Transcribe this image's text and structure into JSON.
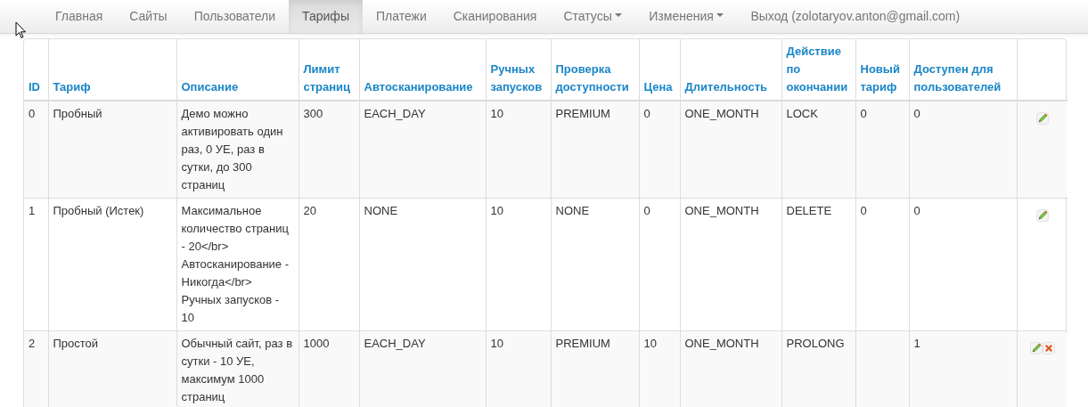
{
  "nav": [
    {
      "label": "Главная",
      "selected": false,
      "kind": "link"
    },
    {
      "label": "Сайты",
      "selected": false,
      "kind": "link"
    },
    {
      "label": "Пользователи",
      "selected": false,
      "kind": "link"
    },
    {
      "label": "Тарифы",
      "selected": true,
      "kind": "link"
    },
    {
      "label": "Платежи",
      "selected": false,
      "kind": "link"
    },
    {
      "label": "Сканирования",
      "selected": false,
      "kind": "link"
    },
    {
      "label": "Статусы",
      "selected": false,
      "kind": "dropdown"
    },
    {
      "label": "Изменения",
      "selected": false,
      "kind": "dropdown"
    },
    {
      "label": "Выход (zolotaryov.anton@gmail.com)",
      "selected": false,
      "kind": "link"
    }
  ],
  "table": {
    "columns": [
      "ID",
      "Тариф",
      "Описание",
      "Лимит страниц",
      "Автосканирование",
      "Ручных запусков",
      "Проверка доступности",
      "Цена",
      "Длительность",
      "Действие по окончании",
      "Новый тариф",
      "Доступен для пользователей"
    ],
    "rows": [
      {
        "cells": [
          "0",
          "Пробный",
          "Демо можно активировать один раз, 0 УЕ, раз в сутки, до 300 страниц",
          "300",
          "EACH_DAY",
          "10",
          "PREMIUM",
          "0",
          "ONE_MONTH",
          "LOCK",
          "0",
          "0"
        ],
        "deletable": false
      },
      {
        "cells": [
          "1",
          "Пробный (Истек)",
          "Максимальное количество страниц - 20</br> Автосканирование - Никогда</br> Ручных запусков - 10",
          "20",
          "NONE",
          "10",
          "NONE",
          "0",
          "ONE_MONTH",
          "DELETE",
          "0",
          "0"
        ],
        "deletable": false
      },
      {
        "cells": [
          "2",
          "Простой",
          "Обычный сайт, раз в сутки - 10 УЕ, максимум 1000 страниц",
          "1000",
          "EACH_DAY",
          "10",
          "PREMIUM",
          "10",
          "ONE_MONTH",
          "PROLONG",
          "",
          "1"
        ],
        "deletable": true
      }
    ]
  }
}
